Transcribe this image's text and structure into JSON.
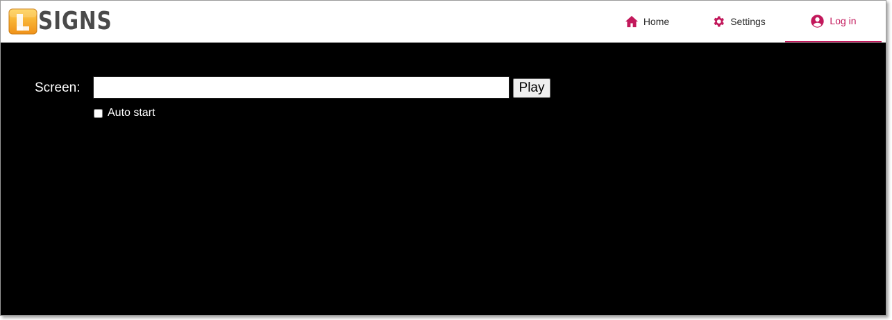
{
  "logo": {
    "text": "SIGNS"
  },
  "nav": {
    "items": [
      {
        "label": "Home",
        "icon": "home-icon"
      },
      {
        "label": "Settings",
        "icon": "gear-icon"
      },
      {
        "label": "Log in",
        "icon": "account-circle-icon",
        "active": true
      }
    ]
  },
  "form": {
    "screen_label": "Screen:",
    "screen_value": "",
    "play_label": "Play",
    "autostart_label": "Auto start",
    "autostart_checked": false
  },
  "colors": {
    "accent": "#c2185b",
    "content_background": "#000000",
    "header_background": "#ffffff",
    "logo_orange": "#f5a623",
    "logo_text": "#4a4a4a"
  }
}
